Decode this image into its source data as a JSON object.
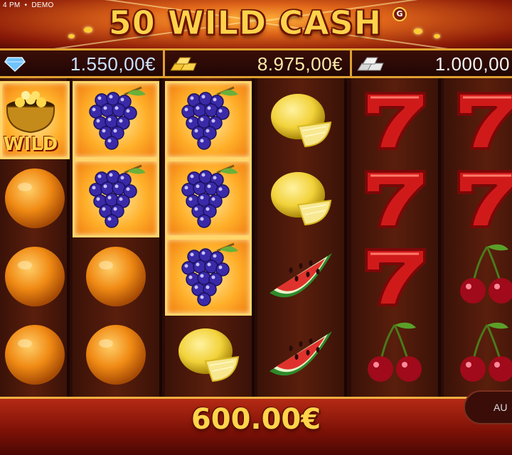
{
  "status": {
    "time": "4 PM",
    "mode": "DEMO"
  },
  "header": {
    "title": "50 WILD CASH",
    "badge": "G"
  },
  "jackpots": [
    {
      "icon": "diamond-icon",
      "value": "1.550,00€"
    },
    {
      "icon": "gold-bars-icon",
      "value": "8.975,00€"
    },
    {
      "icon": "silver-bars-icon",
      "value": "1.000,00"
    }
  ],
  "reels": [
    [
      "wild",
      "orange",
      "orange",
      "orange"
    ],
    [
      "grapes",
      "grapes",
      "orange",
      "orange"
    ],
    [
      "grapes",
      "grapes",
      "grapes",
      "lemon"
    ],
    [
      "lemon",
      "lemon",
      "watermelon",
      "watermelon"
    ],
    [
      "seven",
      "seven",
      "seven",
      "cherries"
    ],
    [
      "seven",
      "seven",
      "cherries",
      "cherries"
    ]
  ],
  "win_highlight": [
    [
      0,
      0
    ],
    [
      1,
      0
    ],
    [
      1,
      1
    ],
    [
      2,
      0
    ],
    [
      2,
      1
    ],
    [
      2,
      2
    ]
  ],
  "wild_label": "WILD",
  "win": {
    "amount": "600.00€"
  },
  "controls": {
    "auto_label": "AU"
  },
  "colors": {
    "gold": "#ffd24a",
    "frame": "#e0a030",
    "background": "#2b0b06"
  }
}
